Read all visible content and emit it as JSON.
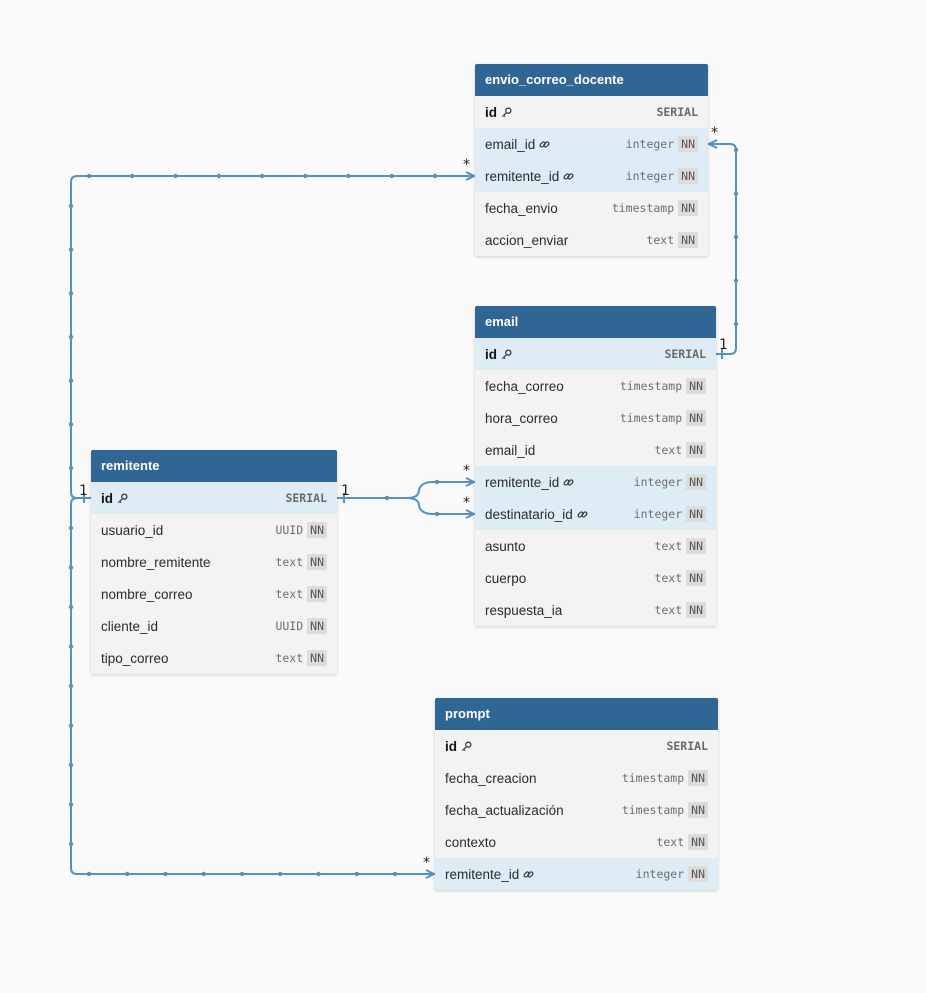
{
  "tables": [
    {
      "name": "envio_correo_docente",
      "fields": [
        {
          "name": "id",
          "type": "SERIAL",
          "nn": "",
          "pk": true,
          "fk": false,
          "highlight": false
        },
        {
          "name": "email_id",
          "type": "integer",
          "nn": "NN",
          "pk": false,
          "fk": true,
          "highlight": true
        },
        {
          "name": "remitente_id",
          "type": "integer",
          "nn": "NN",
          "pk": false,
          "fk": true,
          "highlight": true
        },
        {
          "name": "fecha_envio",
          "type": "timestamp",
          "nn": "NN",
          "pk": false,
          "fk": false,
          "highlight": false
        },
        {
          "name": "accion_enviar",
          "type": "text",
          "nn": "NN",
          "pk": false,
          "fk": false,
          "highlight": false
        }
      ]
    },
    {
      "name": "email",
      "fields": [
        {
          "name": "id",
          "type": "SERIAL",
          "nn": "",
          "pk": true,
          "fk": false,
          "highlight": true
        },
        {
          "name": "fecha_correo",
          "type": "timestamp",
          "nn": "NN",
          "pk": false,
          "fk": false,
          "highlight": false
        },
        {
          "name": "hora_correo",
          "type": "timestamp",
          "nn": "NN",
          "pk": false,
          "fk": false,
          "highlight": false
        },
        {
          "name": "email_id",
          "type": "text",
          "nn": "NN",
          "pk": false,
          "fk": false,
          "highlight": false
        },
        {
          "name": "remitente_id",
          "type": "integer",
          "nn": "NN",
          "pk": false,
          "fk": true,
          "highlight": true
        },
        {
          "name": "destinatario_id",
          "type": "integer",
          "nn": "NN",
          "pk": false,
          "fk": true,
          "highlight": true
        },
        {
          "name": "asunto",
          "type": "text",
          "nn": "NN",
          "pk": false,
          "fk": false,
          "highlight": false
        },
        {
          "name": "cuerpo",
          "type": "text",
          "nn": "NN",
          "pk": false,
          "fk": false,
          "highlight": false
        },
        {
          "name": "respuesta_ia",
          "type": "text",
          "nn": "NN",
          "pk": false,
          "fk": false,
          "highlight": false
        }
      ]
    },
    {
      "name": "remitente",
      "fields": [
        {
          "name": "id",
          "type": "SERIAL",
          "nn": "",
          "pk": true,
          "fk": false,
          "highlight": true
        },
        {
          "name": "usuario_id",
          "type": "UUID",
          "nn": "NN",
          "pk": false,
          "fk": false,
          "highlight": false
        },
        {
          "name": "nombre_remitente",
          "type": "text",
          "nn": "NN",
          "pk": false,
          "fk": false,
          "highlight": false
        },
        {
          "name": "nombre_correo",
          "type": "text",
          "nn": "NN",
          "pk": false,
          "fk": false,
          "highlight": false
        },
        {
          "name": "cliente_id",
          "type": "UUID",
          "nn": "NN",
          "pk": false,
          "fk": false,
          "highlight": false
        },
        {
          "name": "tipo_correo",
          "type": "text",
          "nn": "NN",
          "pk": false,
          "fk": false,
          "highlight": false
        }
      ]
    },
    {
      "name": "prompt",
      "fields": [
        {
          "name": "id",
          "type": "SERIAL",
          "nn": "",
          "pk": true,
          "fk": false,
          "highlight": false
        },
        {
          "name": "fecha_creacion",
          "type": "timestamp",
          "nn": "NN",
          "pk": false,
          "fk": false,
          "highlight": false
        },
        {
          "name": "fecha_actualización",
          "type": "timestamp",
          "nn": "NN",
          "pk": false,
          "fk": false,
          "highlight": false
        },
        {
          "name": "contexto",
          "type": "text",
          "nn": "NN",
          "pk": false,
          "fk": false,
          "highlight": false
        },
        {
          "name": "remitente_id",
          "type": "integer",
          "nn": "NN",
          "pk": false,
          "fk": true,
          "highlight": true
        }
      ]
    }
  ],
  "relationships": [
    {
      "from": "envio_correo_docente.email_id",
      "to": "email.id",
      "from_cardinality": "*",
      "to_cardinality": "1"
    },
    {
      "from": "envio_correo_docente.remitente_id",
      "to": "remitente.id",
      "from_cardinality": "*",
      "to_cardinality": "1"
    },
    {
      "from": "email.remitente_id",
      "to": "remitente.id",
      "from_cardinality": "*",
      "to_cardinality": "1"
    },
    {
      "from": "email.destinatario_id",
      "to": "remitente.id",
      "from_cardinality": "*",
      "to_cardinality": ""
    },
    {
      "from": "prompt.remitente_id",
      "to": "remitente.id",
      "from_cardinality": "*",
      "to_cardinality": ""
    }
  ],
  "icons": {
    "primary_key": "key-icon",
    "foreign_key": "link-icon"
  },
  "colors": {
    "header": "#2f6693",
    "header_text": "#ffffff",
    "row_bg": "#f3f3f3",
    "key_row_bg": "#deecf5",
    "connector": "#5592c1",
    "background": "#fafafa"
  }
}
